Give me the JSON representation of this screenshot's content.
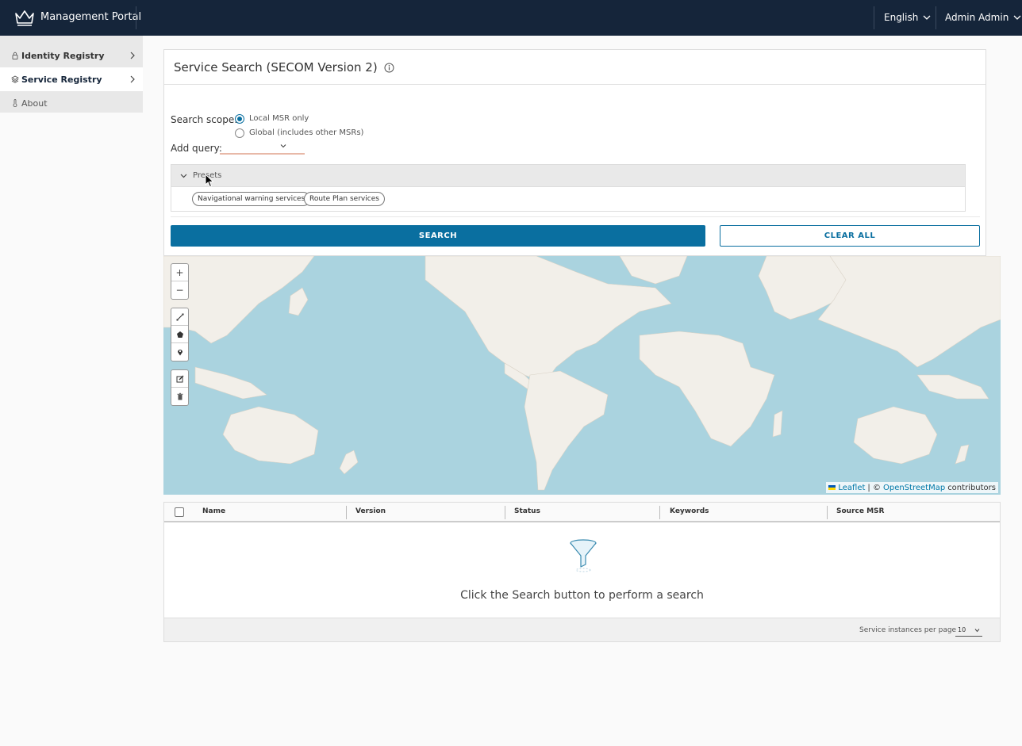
{
  "header": {
    "app_title": "Management Portal",
    "language": "English",
    "user": "Admin Admin"
  },
  "sidebar": {
    "items": [
      {
        "label": "Identity Registry"
      },
      {
        "label": "Service Registry"
      },
      {
        "label": "About"
      }
    ]
  },
  "search_card": {
    "title": "Service Search (SECOM Version 2)",
    "scope_label": "Search scope:",
    "scope_options": [
      {
        "label": "Local MSR only",
        "checked": true
      },
      {
        "label": "Global (includes other MSRs)",
        "checked": false
      }
    ],
    "add_query_label": "Add query:",
    "presets_label": "Presets",
    "presets": [
      "Navigational warning services",
      "Route Plan services"
    ],
    "search_button": "SEARCH",
    "clear_button": "CLEAR ALL"
  },
  "map": {
    "zoom_in": "+",
    "zoom_out": "−",
    "attribution_leaflet": "Leaflet",
    "attribution_sep": "| ©",
    "attribution_osm": "OpenStreetMap",
    "attribution_contrib": "contributors",
    "colors": {
      "water": "#aad3df",
      "land": "#f2efe9"
    }
  },
  "results_table": {
    "columns": [
      "Name",
      "Version",
      "Status",
      "Keywords",
      "Source MSR"
    ],
    "empty_message": "Click the Search button to perform a search",
    "per_page_label": "Service instances per page",
    "per_page_value": "10"
  },
  "colors": {
    "header_bg": "#15253a",
    "primary": "#0a6fa0"
  }
}
